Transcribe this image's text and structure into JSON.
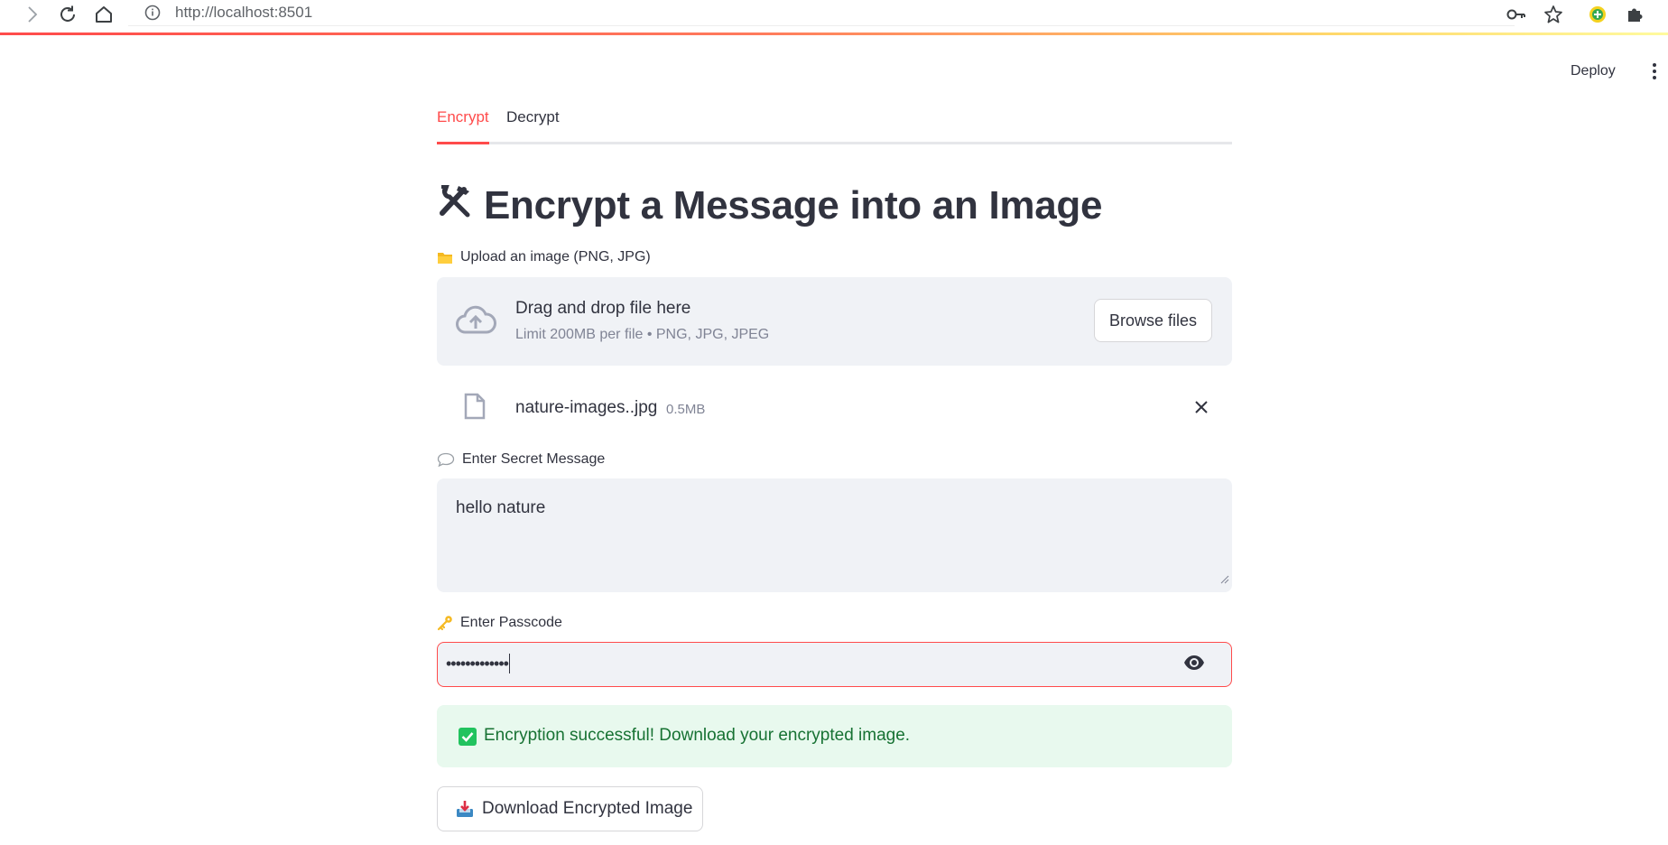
{
  "browser": {
    "url": "http://localhost:8501"
  },
  "header": {
    "deploy_label": "Deploy"
  },
  "tabs": [
    {
      "label": "Encrypt",
      "active": true
    },
    {
      "label": "Decrypt",
      "active": false
    }
  ],
  "page": {
    "title": "Encrypt a Message into an Image",
    "title_icon": "hammer-and-wrench-icon"
  },
  "upload": {
    "label": "Upload an image (PNG, JPG)",
    "label_icon": "folder-icon",
    "drop_title": "Drag and drop file here",
    "drop_limit": "Limit 200MB per file • PNG, JPG, JPEG",
    "browse_label": "Browse files",
    "file": {
      "name": "nature-images..jpg",
      "size": "0.5MB"
    }
  },
  "message": {
    "label": "Enter Secret Message",
    "label_icon": "speech-bubble-icon",
    "value": "hello nature"
  },
  "passcode": {
    "label": "Enter Passcode",
    "label_icon": "key-icon",
    "masked_value": "•••••••••••••"
  },
  "alert": {
    "text": "Encryption successful! Download your encrypted image.",
    "icon": "check-box-icon"
  },
  "download": {
    "label": "Download Encrypted Image",
    "icon": "inbox-tray-icon"
  },
  "colors": {
    "accent": "#ff4b4b",
    "success_bg": "#e8f9ee",
    "success_text": "#177233",
    "input_bg": "#f0f2f6"
  }
}
